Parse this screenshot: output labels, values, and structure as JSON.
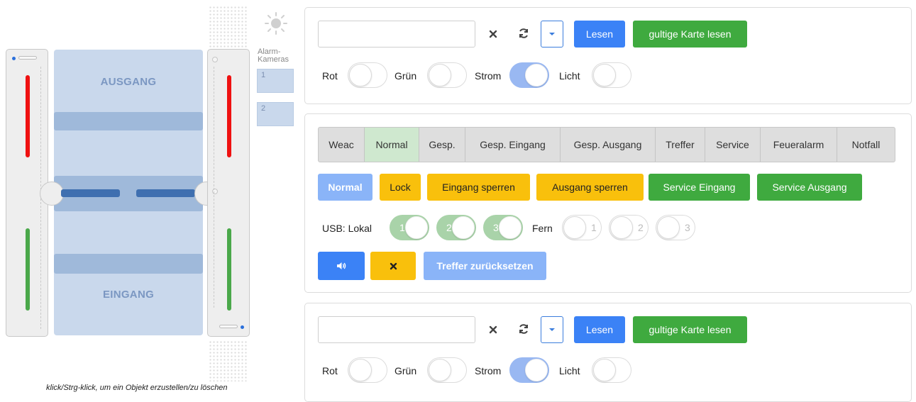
{
  "gate": {
    "lane_out_label": "AUSGANG",
    "lane_in_label": "EINGANG",
    "alarm_title": "Alarm-\nKameras",
    "cameras": [
      "1",
      "2"
    ],
    "hint": "klick/Strg-klick, um ein Objekt erzustellen/zu löschen"
  },
  "reader1": {
    "input_value": "",
    "clear_icon": "close-icon",
    "refresh_icon": "refresh-icon",
    "read_label": "Lesen",
    "valid_label": "gultige Karte lesen",
    "toggles": [
      {
        "label": "Rot",
        "on": false
      },
      {
        "label": "Grün",
        "on": false
      },
      {
        "label": "Strom",
        "on": true
      },
      {
        "label": "Licht",
        "on": false
      }
    ]
  },
  "control": {
    "modes": [
      "Weac",
      "Normal",
      "Gesp.",
      "Gesp. Eingang",
      "Gesp. Ausgang",
      "Treffer",
      "Service",
      "Feueralarm",
      "Notfall"
    ],
    "active_mode": "Normal",
    "actions": [
      "Normal",
      "Lock",
      "Eingang sperren",
      "Ausgang sperren",
      "Service Eingang",
      "Service Ausgang"
    ],
    "usb_label": "USB: Lokal",
    "fern_label": "Fern",
    "usb_local": [
      "1",
      "2",
      "3"
    ],
    "usb_remote": [
      "1",
      "2",
      "3"
    ],
    "sound_icon": "speaker-icon",
    "mute_icon": "close-icon",
    "reset_label": "Treffer zurücksetzen"
  },
  "reader2": {
    "input_value": "",
    "read_label": "Lesen",
    "valid_label": "gultige Karte lesen",
    "toggles": [
      {
        "label": "Rot",
        "on": false
      },
      {
        "label": "Grün",
        "on": false
      },
      {
        "label": "Strom",
        "on": true
      },
      {
        "label": "Licht",
        "on": false
      }
    ]
  },
  "colors": {
    "primary": "#3b82f6",
    "success": "#3faa3f",
    "warning": "#f9c00c",
    "lane": "#c9d8ec",
    "led_red": "#ef1111",
    "led_green": "#4aa84a"
  }
}
